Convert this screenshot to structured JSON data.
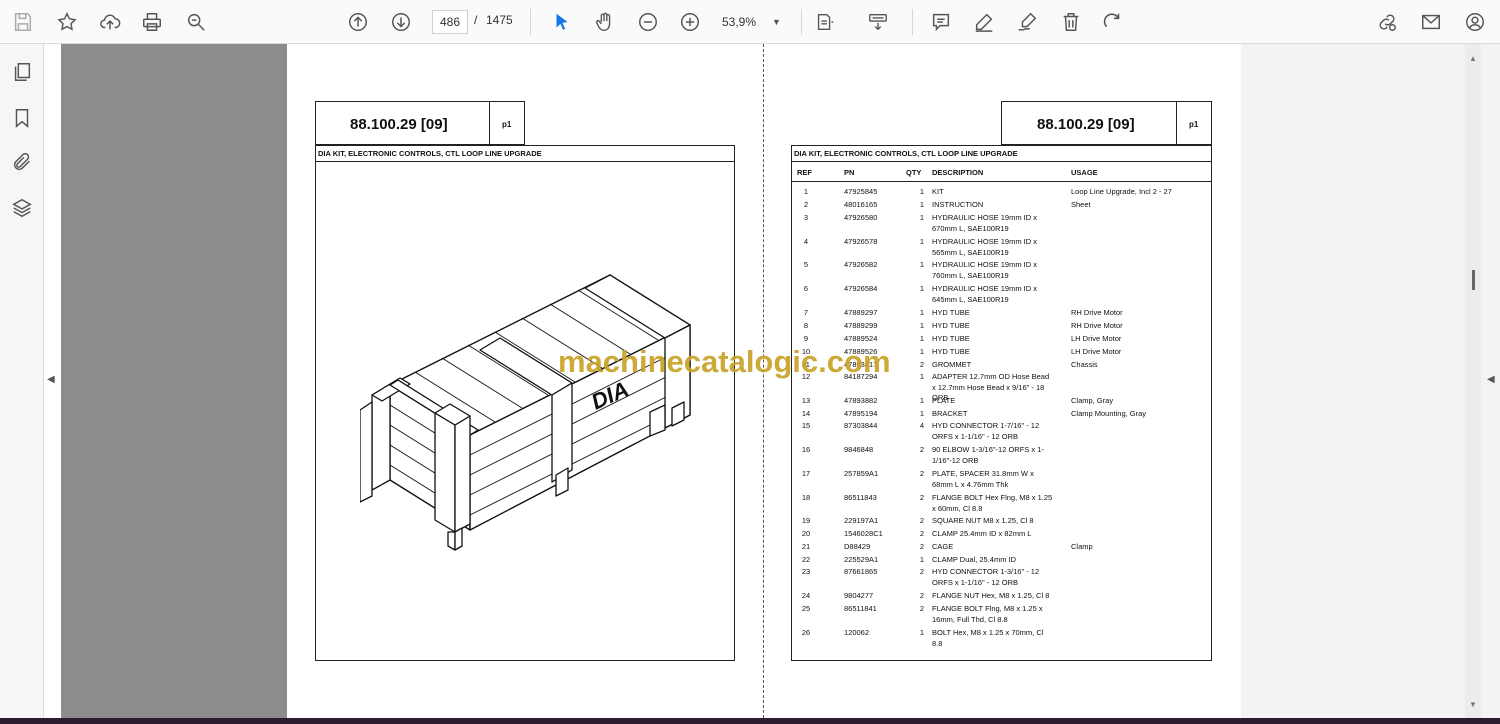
{
  "toolbar": {
    "page_current": "486",
    "page_separator": "/",
    "page_total": "1475",
    "zoom_value": "53,9%"
  },
  "doc": {
    "code": "88.100.29 [09]",
    "page_tag": "p1",
    "title": "DIA KIT, ELECTRONIC CONTROLS, CTL LOOP LINE UPGRADE",
    "crate_label": "DIA"
  },
  "table": {
    "headers": {
      "ref": "REF",
      "pn": "PN",
      "qty": "QTY",
      "desc": "DESCRIPTION",
      "usage": "USAGE"
    },
    "rows": [
      {
        "ref": "1",
        "pn": "47925845",
        "qty": "1",
        "desc": "KIT",
        "usage": "Loop Line Upgrade, Incl 2 - 27"
      },
      {
        "ref": "2",
        "pn": "48016165",
        "qty": "1",
        "desc": "INSTRUCTION",
        "usage": "Sheet"
      },
      {
        "ref": "3",
        "pn": "47926580",
        "qty": "1",
        "desc": "HYDRAULIC HOSE 19mm ID x 670mm L, SAE100R19",
        "usage": ""
      },
      {
        "ref": "4",
        "pn": "47926578",
        "qty": "1",
        "desc": "HYDRAULIC HOSE 19mm ID x 565mm L, SAE100R19",
        "usage": ""
      },
      {
        "ref": "5",
        "pn": "47926582",
        "qty": "1",
        "desc": "HYDRAULIC HOSE 19mm ID x 760mm L, SAE100R19",
        "usage": ""
      },
      {
        "ref": "6",
        "pn": "47926584",
        "qty": "1",
        "desc": "HYDRAULIC HOSE 19mm ID x 645mm L, SAE100R19",
        "usage": ""
      },
      {
        "ref": "7",
        "pn": "47889297",
        "qty": "1",
        "desc": "HYD TUBE",
        "usage": "RH Drive Motor"
      },
      {
        "ref": "8",
        "pn": "47889299",
        "qty": "1",
        "desc": "HYD TUBE",
        "usage": "RH Drive Motor"
      },
      {
        "ref": "9",
        "pn": "47889524",
        "qty": "1",
        "desc": "HYD TUBE",
        "usage": "LH Drive Motor"
      },
      {
        "ref": "10",
        "pn": "47889526",
        "qty": "1",
        "desc": "HYD TUBE",
        "usage": "LH Drive Motor"
      },
      {
        "ref": "11",
        "pn": "47893417",
        "qty": "2",
        "desc": "GROMMET",
        "usage": "Chassis"
      },
      {
        "ref": "12",
        "pn": "84187294",
        "qty": "1",
        "desc": "ADAPTER 12.7mm OD Hose Bead x 12.7mm Hose Bead x 9/16\" - 18 ORB",
        "usage": ""
      },
      {
        "ref": "13",
        "pn": "47893882",
        "qty": "1",
        "desc": "PLATE",
        "usage": "Clamp, Gray"
      },
      {
        "ref": "14",
        "pn": "47895194",
        "qty": "1",
        "desc": "BRACKET",
        "usage": "Clamp Mounting, Gray"
      },
      {
        "ref": "15",
        "pn": "87303844",
        "qty": "4",
        "desc": "HYD CONNECTOR 1-7/16\" - 12 ORFS x 1-1/16\" - 12 ORB",
        "usage": ""
      },
      {
        "ref": "16",
        "pn": "9846848",
        "qty": "2",
        "desc": "90 ELBOW 1-3/16\"-12 ORFS x 1-1/16\"-12 ORB",
        "usage": ""
      },
      {
        "ref": "17",
        "pn": "257859A1",
        "qty": "2",
        "desc": "PLATE, SPACER 31.8mm W x 68mm L x 4.76mm Thk",
        "usage": ""
      },
      {
        "ref": "18",
        "pn": "86511843",
        "qty": "2",
        "desc": "FLANGE BOLT Hex Flng, M8 x 1.25 x 60mm, Cl 8.8",
        "usage": ""
      },
      {
        "ref": "19",
        "pn": "229197A1",
        "qty": "2",
        "desc": "SQUARE NUT M8 x 1.25, Cl 8",
        "usage": ""
      },
      {
        "ref": "20",
        "pn": "1546028C1",
        "qty": "2",
        "desc": "CLAMP 25.4mm ID x 82mm L",
        "usage": ""
      },
      {
        "ref": "21",
        "pn": "D88429",
        "qty": "2",
        "desc": "CAGE",
        "usage": "Clamp"
      },
      {
        "ref": "22",
        "pn": "225529A1",
        "qty": "1",
        "desc": "CLAMP Dual, 25.4mm ID",
        "usage": ""
      },
      {
        "ref": "23",
        "pn": "87661865",
        "qty": "2",
        "desc": "HYD CONNECTOR 1-3/16\" - 12 ORFS x 1-1/16\" - 12 ORB",
        "usage": ""
      },
      {
        "ref": "24",
        "pn": "9804277",
        "qty": "2",
        "desc": "FLANGE NUT Hex, M8 x 1.25, Cl 8",
        "usage": ""
      },
      {
        "ref": "25",
        "pn": "86511841",
        "qty": "2",
        "desc": "FLANGE BOLT Flng, M8 x 1.25 x 16mm, Full Thd, Cl 8.8",
        "usage": ""
      },
      {
        "ref": "26",
        "pn": "120062",
        "qty": "1",
        "desc": "BOLT Hex, M8 x 1.25 x 70mm, Cl 8.8",
        "usage": ""
      }
    ]
  },
  "watermark": "machinecatalogic.com",
  "colors": {
    "toolbar_bg": "#fafafa",
    "viewer_bg": "#8c8c8c",
    "accent": "#1473e6",
    "watermark": "#c9a227"
  }
}
